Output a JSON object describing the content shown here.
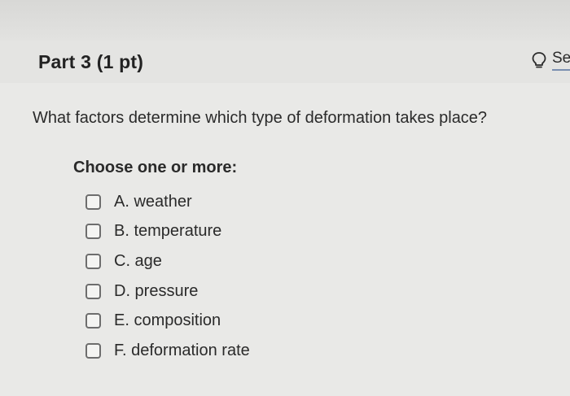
{
  "header": {
    "part_title": "Part 3 (1 pt)",
    "hint_label": "Se"
  },
  "question": {
    "text": "What factors determine which type of deformation takes place?",
    "instruction": "Choose one or more:",
    "options": [
      {
        "label": "A. weather",
        "checked": false
      },
      {
        "label": "B. temperature",
        "checked": false
      },
      {
        "label": "C. age",
        "checked": false
      },
      {
        "label": "D. pressure",
        "checked": false
      },
      {
        "label": "E. composition",
        "checked": false
      },
      {
        "label": "F. deformation rate",
        "checked": false
      }
    ]
  },
  "icons": {
    "hint": "lightbulb-icon"
  }
}
